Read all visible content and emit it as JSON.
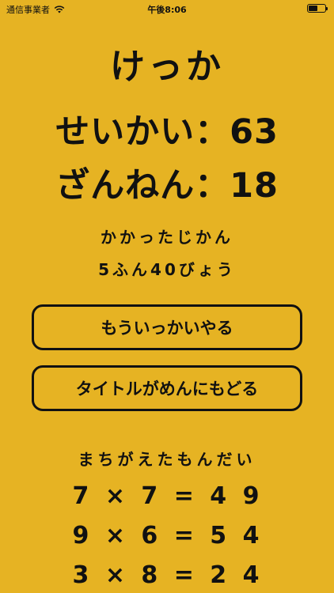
{
  "status_bar": {
    "carrier": "通信事業者",
    "time": "午後8:06"
  },
  "result": {
    "title": "けっか",
    "correct_line": "せいかい：63",
    "wrong_line": "ざんねん：18"
  },
  "time_taken": {
    "label": "かかったじかん",
    "value": "5ふん40びょう"
  },
  "buttons": {
    "retry": "もういっかいやる",
    "back_to_title": "タイトルがめんにもどる"
  },
  "mistakes": {
    "heading": "まちがえたもんだい",
    "rows": [
      "7 × 7 = 4 9",
      "9 × 6 = 5 4",
      "3 × 8 = 2 4"
    ]
  }
}
